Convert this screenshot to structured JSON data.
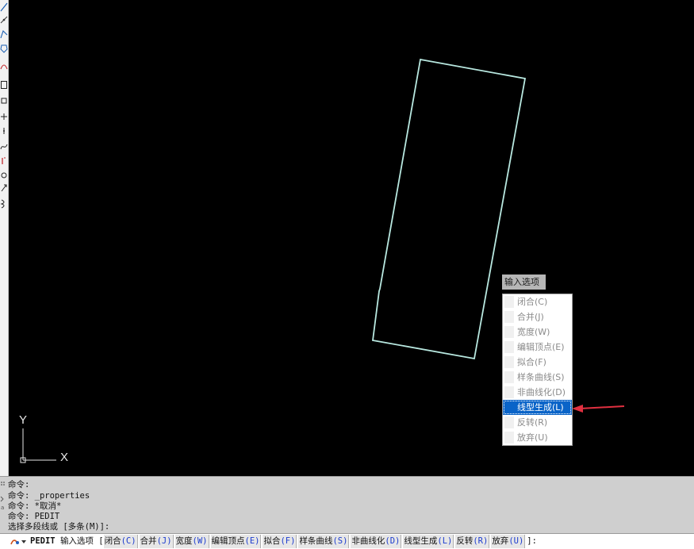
{
  "toolbar": {
    "buttons": [
      {
        "name": "line-tool",
        "glyph": "⟋"
      },
      {
        "name": "construction-line-tool",
        "glyph": "↗"
      },
      {
        "name": "polyline-tool",
        "glyph": "⤺"
      },
      {
        "name": "polygon-tool",
        "glyph": "⬡"
      },
      {
        "name": "rectangle-tool",
        "glyph": "▭"
      },
      {
        "name": "arc-tool",
        "glyph": "◠"
      },
      {
        "name": "circle-tool",
        "glyph": "○"
      },
      {
        "name": "spline-tool",
        "glyph": "∿"
      },
      {
        "name": "ellipse-tool",
        "glyph": "⬭"
      }
    ]
  },
  "canvas": {
    "ucs": {
      "y_label": "Y",
      "x_label": "X"
    },
    "polyline_color": "#b8e8e0"
  },
  "dynamic_input": {
    "tooltip": "输入选项",
    "options": [
      {
        "label": "闭合(C)",
        "selected": false
      },
      {
        "label": "合并(J)",
        "selected": false
      },
      {
        "label": "宽度(W)",
        "selected": false
      },
      {
        "label": "编辑顶点(E)",
        "selected": false
      },
      {
        "label": "拟合(F)",
        "selected": false
      },
      {
        "label": "样条曲线(S)",
        "selected": false
      },
      {
        "label": "非曲线化(D)",
        "selected": false
      },
      {
        "label": "线型生成(L)",
        "selected": true
      },
      {
        "label": "反转(R)",
        "selected": false
      },
      {
        "label": "放弃(U)",
        "selected": false
      }
    ]
  },
  "command_history": {
    "lines": [
      "命令:",
      "命令: _properties",
      "命令: *取消*",
      "命令: PEDIT",
      "选择多段线或 [多条(M)]:"
    ]
  },
  "command_line": {
    "command": "PEDIT",
    "prompt": "输入选项 [",
    "options": [
      {
        "label": "闭合",
        "key": "(C)"
      },
      {
        "label": "合并",
        "key": "(J)"
      },
      {
        "label": "宽度",
        "key": "(W)"
      },
      {
        "label": "编辑顶点",
        "key": "(E)"
      },
      {
        "label": "拟合",
        "key": "(F)"
      },
      {
        "label": "样条曲线",
        "key": "(S)"
      },
      {
        "label": "非曲线化",
        "key": "(D)"
      },
      {
        "label": "线型生成",
        "key": "(L)"
      },
      {
        "label": "反转",
        "key": "(R)"
      },
      {
        "label": "放弃",
        "key": "(U)"
      }
    ],
    "suffix": "]:"
  },
  "colors": {
    "accent": "#0a64c8",
    "arrow": "#e03040",
    "canvas_bg": "#000000",
    "command_bg": "#cfcfcf"
  }
}
